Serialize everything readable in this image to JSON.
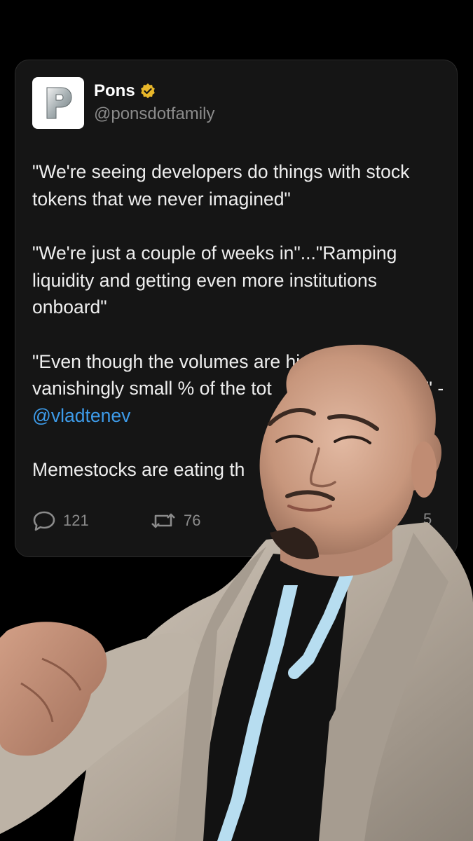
{
  "tweet": {
    "author": {
      "name": "Pons",
      "handle": "@ponsdotfamily"
    },
    "paragraphs": [
      "\"We're seeing developers do things with stock tokens that we never imagined\"",
      "\"We're just a couple of weeks in\"...\"Ramping liquidity and getting even more institutions onboard\"",
      "\"Even though the volumes are hi",
      "till a vanishingly small % of the tot",
      "t in size\" - ",
      "Memestocks are eating th"
    ],
    "mention": "@vladtenev",
    "stats": {
      "replies": "121",
      "reposts": "76",
      "likes": "5"
    }
  },
  "colors": {
    "page_background": "#000000",
    "card_background": "#151515",
    "text": "#eeeeee",
    "muted": "#8b8b8b",
    "link": "#3d9be9",
    "verified_badge": "#e8b72a"
  },
  "icons": {
    "logo": "pons-p-logo-icon",
    "verified": "verified-badge-icon",
    "reply": "reply-bubble-icon",
    "repost": "repost-icon"
  }
}
